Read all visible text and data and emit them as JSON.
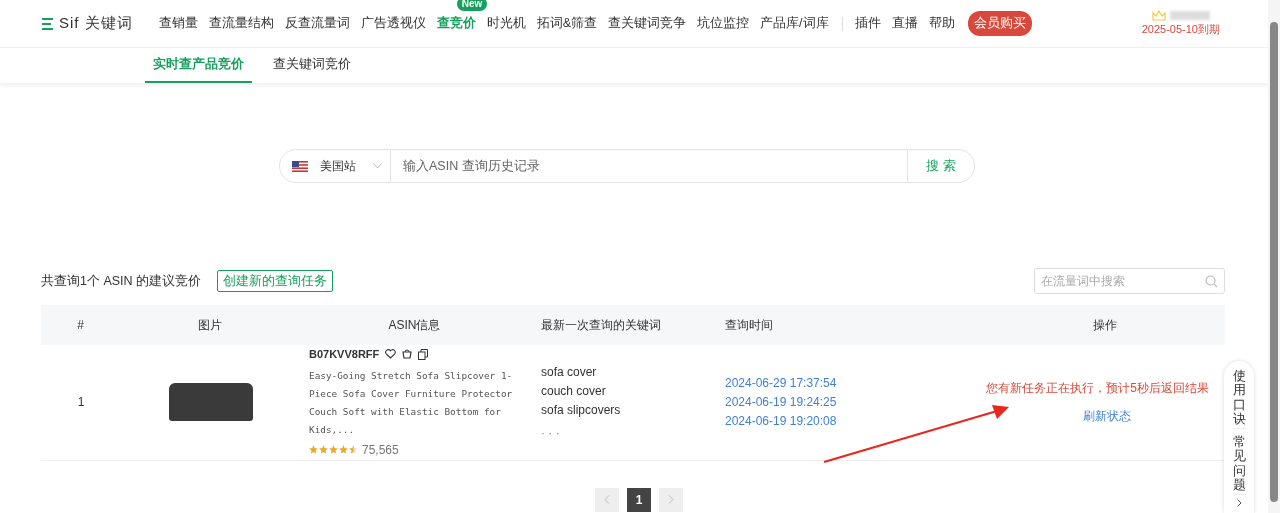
{
  "logo": {
    "text": "Sif 关键词"
  },
  "nav": [
    {
      "label": "查销量",
      "selected": false
    },
    {
      "label": "查流量结构",
      "selected": false
    },
    {
      "label": "反查流量词",
      "selected": false
    },
    {
      "label": "广告透视仪",
      "selected": false
    },
    {
      "label": "查竞价",
      "selected": true,
      "badge": "New"
    },
    {
      "label": "时光机",
      "selected": false
    },
    {
      "label": "拓词&筛查",
      "selected": false
    },
    {
      "label": "查关键词竞争",
      "selected": false
    },
    {
      "label": "坑位监控",
      "selected": false
    },
    {
      "label": "产品库/词库",
      "selected": false
    }
  ],
  "nav_extra": [
    "插件",
    "直播",
    "帮助"
  ],
  "vip_button": "会员购买",
  "account": {
    "expiry": "2025-05-10到期"
  },
  "sub_tabs": [
    {
      "label": "实时查产品竞价",
      "selected": true
    },
    {
      "label": "查关键词竞价",
      "selected": false
    }
  ],
  "search": {
    "region": "美国站",
    "placeholder": "输入ASIN 查询历史记录",
    "button": "搜 索"
  },
  "summary": "共查询1个 ASIN 的建议竞价",
  "create_button": "创建新的查询任务",
  "filter": {
    "placeholder": "在流量词中搜索"
  },
  "table": {
    "columns": [
      "#",
      "图片",
      "ASIN信息",
      "最新一次查询的关键词",
      "查询时间",
      "操作"
    ],
    "rows": [
      {
        "index": "1",
        "asin": "B07KVV8RFF",
        "title": "Easy-Going Stretch Sofa Slipcover 1-Piece Sofa Cover Furniture Protector Couch Soft with Elastic Bottom for Kids,...",
        "stars": 4.5,
        "reviews": "75,565",
        "keywords": [
          "sofa cover",
          "couch cover",
          "sofa slipcovers"
        ],
        "more": "· · ·",
        "times": [
          "2024-06-29 17:37:54",
          "2024-06-19 19:24:25",
          "2024-06-19 19:20:08"
        ],
        "status": "您有新任务正在执行，预计5秒后返回结果",
        "action": "刷新状态"
      }
    ]
  },
  "pagination": {
    "pages": [
      {
        "label": "1",
        "selected": true
      }
    ]
  },
  "side_panel": [
    "使用口诀",
    "常见问题"
  ]
}
